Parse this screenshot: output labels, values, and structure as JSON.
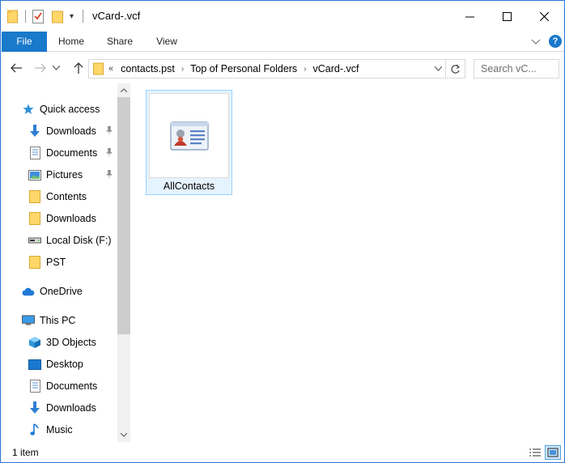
{
  "window": {
    "title": "vCard-.vcf"
  },
  "ribbon": {
    "tabs": [
      {
        "label": "File"
      },
      {
        "label": "Home"
      },
      {
        "label": "Share"
      },
      {
        "label": "View"
      }
    ],
    "help_label": "?"
  },
  "address": {
    "overflow_chevron": "«",
    "crumbs": [
      "contacts.pst",
      "Top of Personal Folders",
      "vCard-.vcf"
    ]
  },
  "search": {
    "placeholder": "Search vC..."
  },
  "nav_pane": {
    "items": [
      {
        "label": "Quick access",
        "icon": "star-icon"
      },
      {
        "label": "Downloads",
        "icon": "download-arrow-icon",
        "pinned": true
      },
      {
        "label": "Documents",
        "icon": "document-icon",
        "pinned": true
      },
      {
        "label": "Pictures",
        "icon": "pictures-icon",
        "pinned": true
      },
      {
        "label": "Contents",
        "icon": "folder-icon"
      },
      {
        "label": "Downloads",
        "icon": "folder-icon"
      },
      {
        "label": "Local Disk (F:)",
        "icon": "drive-icon"
      },
      {
        "label": "PST",
        "icon": "folder-icon"
      },
      {
        "label": "OneDrive",
        "icon": "cloud-icon"
      },
      {
        "label": "This PC",
        "icon": "computer-icon"
      },
      {
        "label": "3D Objects",
        "icon": "cube-icon"
      },
      {
        "label": "Desktop",
        "icon": "desktop-icon"
      },
      {
        "label": "Documents",
        "icon": "document-icon"
      },
      {
        "label": "Downloads",
        "icon": "download-arrow-icon"
      },
      {
        "label": "Music",
        "icon": "music-note-icon"
      }
    ]
  },
  "content": {
    "files": [
      {
        "name": "AllContacts",
        "icon": "contact-card-icon"
      }
    ]
  },
  "status": {
    "item_count": "1 item"
  },
  "colors": {
    "accent": "#1979ca",
    "folder": "#ffd769",
    "selection_fill": "#e5f3ff",
    "selection_border": "#99d1ff"
  }
}
